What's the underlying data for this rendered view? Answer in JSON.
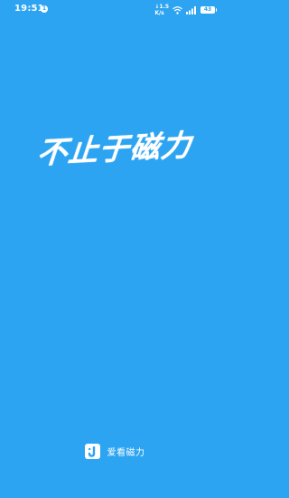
{
  "status_bar": {
    "time": "19:51",
    "notification_badge": "1",
    "net_speed_top": "↓1.5",
    "net_speed_bottom": "K/s",
    "battery_level": "43"
  },
  "splash": {
    "slogan": "不止于磁力"
  },
  "footer": {
    "app_name": "爱看磁力",
    "logo_icon": "j-logo-icon"
  },
  "colors": {
    "background": "#2CA4F2",
    "text": "#FFFFFF",
    "logo_accent": "#2CA4F2"
  }
}
